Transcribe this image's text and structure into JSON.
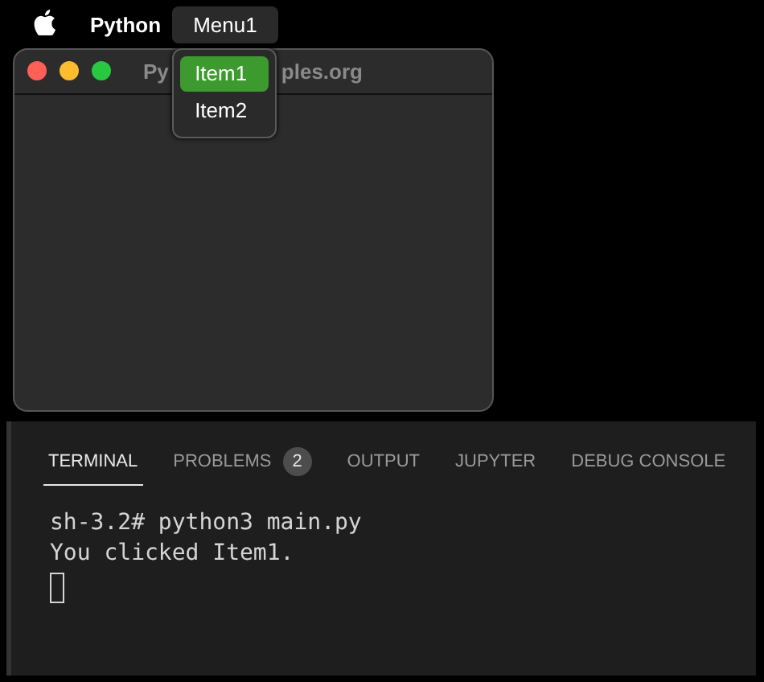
{
  "menu_bar": {
    "app_name": "Python",
    "menus": [
      {
        "label": "Menu1",
        "open": true,
        "items": [
          {
            "label": "Item1",
            "selected": true
          },
          {
            "label": "Item2",
            "selected": false
          }
        ]
      }
    ]
  },
  "window": {
    "title_visible_parts": [
      "Py",
      "ples.org"
    ]
  },
  "panel": {
    "tabs": [
      {
        "label": "TERMINAL",
        "selected": true
      },
      {
        "label": "PROBLEMS",
        "selected": false,
        "badge": "2"
      },
      {
        "label": "OUTPUT",
        "selected": false
      },
      {
        "label": "JUPYTER",
        "selected": false
      },
      {
        "label": "DEBUG CONSOLE",
        "selected": false
      }
    ],
    "terminal_lines": [
      "sh-3.2# python3 main.py",
      "You clicked Item1."
    ],
    "cursor": true
  }
}
